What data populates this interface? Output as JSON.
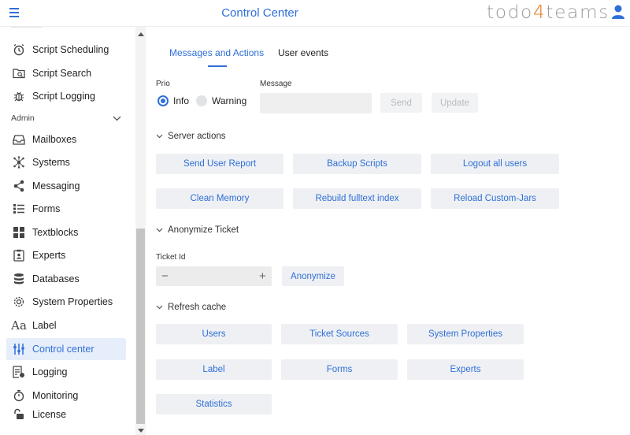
{
  "header": {
    "title": "Control Center",
    "logo_prefix": "todo",
    "logo_digit": "4",
    "logo_suffix": "teams",
    "accent": "#2f6fd8",
    "logo_accent": "#e8761a"
  },
  "sidebar": {
    "items_top": [
      {
        "label": "Script Scheduling",
        "icon": "alarm-clock-icon"
      },
      {
        "label": "Script Search",
        "icon": "folder-search-icon"
      },
      {
        "label": "Script Logging",
        "icon": "bug-icon"
      }
    ],
    "admin_label": "Admin",
    "items_admin": [
      {
        "label": "Mailboxes",
        "icon": "inbox-tray-icon"
      },
      {
        "label": "Systems",
        "icon": "network-hub-icon"
      },
      {
        "label": "Messaging",
        "icon": "share-icon"
      },
      {
        "label": "Forms",
        "icon": "list-form-icon"
      },
      {
        "label": "Textblocks",
        "icon": "grid-blocks-icon"
      },
      {
        "label": "Experts",
        "icon": "expert-badge-icon"
      },
      {
        "label": "Databases",
        "icon": "database-icon"
      },
      {
        "label": "System Properties",
        "icon": "gear-icon"
      },
      {
        "label": "Label",
        "icon": "text-aa-icon"
      },
      {
        "label": "Control center",
        "icon": "sliders-icon",
        "active": true
      },
      {
        "label": "Logging",
        "icon": "log-file-icon"
      },
      {
        "label": "Monitoring",
        "icon": "stopwatch-icon"
      },
      {
        "label": "License",
        "icon": "padlock-icon"
      }
    ]
  },
  "tabs": [
    {
      "label": "Messages and Actions",
      "active": true
    },
    {
      "label": "User events",
      "active": false
    }
  ],
  "messages": {
    "prio_label": "Prio",
    "prio_options": [
      "Info",
      "Warning"
    ],
    "prio_selected": "Info",
    "message_label": "Message",
    "message_value": "",
    "send_label": "Send",
    "update_label": "Update"
  },
  "server_actions": {
    "title": "Server actions",
    "buttons": [
      "Send User Report",
      "Backup Scripts",
      "Logout all users",
      "Clean Memory",
      "Rebuild fulltext index",
      "Reload Custom-Jars"
    ]
  },
  "anonymize": {
    "title": "Anonymize Ticket",
    "ticket_label": "Ticket Id",
    "ticket_value": "",
    "minus": "−",
    "plus": "+",
    "button": "Anonymize"
  },
  "refresh_cache": {
    "title": "Refresh cache",
    "buttons": [
      "Users",
      "Ticket Sources",
      "System Properties",
      "Label",
      "Forms",
      "Experts",
      "Statistics"
    ]
  }
}
